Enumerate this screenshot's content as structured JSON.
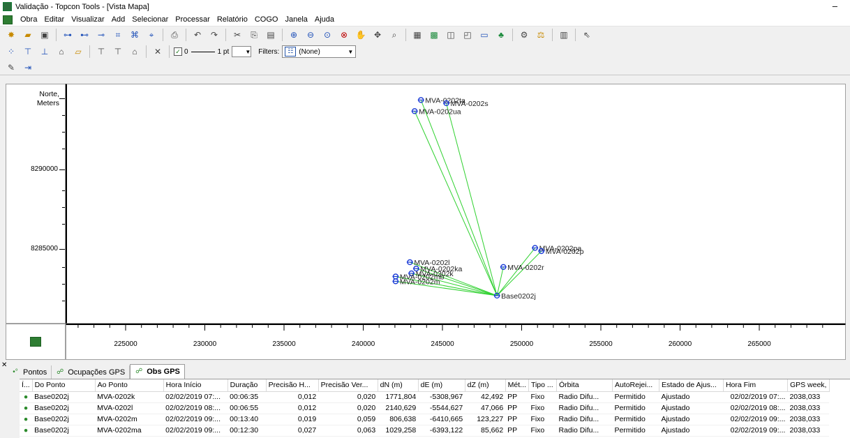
{
  "window": {
    "title": "Validação - Topcon Tools - [Vista Mapa]",
    "minimize": "–"
  },
  "menu": [
    "Obra",
    "Editar",
    "Visualizar",
    "Add",
    "Selecionar",
    "Processar",
    "Relatório",
    "COGO",
    "Janela",
    "Ajuda"
  ],
  "toolbar": {
    "line_weight_value": "0",
    "line_width_label": "1 pt",
    "filters_label": "Filters:",
    "filter_value": "(None)"
  },
  "map": {
    "y_axis_title": [
      "Norte,",
      "Meters"
    ],
    "y_ticks": [
      "8290000",
      "8285000"
    ],
    "x_ticks": [
      "225000",
      "230000",
      "235000",
      "240000",
      "245000",
      "250000",
      "255000",
      "260000",
      "265000"
    ],
    "points": [
      {
        "label": "MVA-0202ta",
        "x": 243.6,
        "y": 8294.5
      },
      {
        "label": "MVA-0202s",
        "x": 245.2,
        "y": 8294.3
      },
      {
        "label": "MVA-0202ua",
        "x": 243.2,
        "y": 8293.8
      },
      {
        "label": "MVA-0202pa",
        "x": 250.8,
        "y": 8285.2
      },
      {
        "label": "MVA-0202p",
        "x": 251.2,
        "y": 8285.0
      },
      {
        "label": "MVA-0202r",
        "x": 248.8,
        "y": 8284.0
      },
      {
        "label": "MVA-0202l",
        "x": 242.9,
        "y": 8284.3
      },
      {
        "label": "MVA-0202ka",
        "x": 243.3,
        "y": 8283.9
      },
      {
        "label": "MVA-0202k",
        "x": 243.0,
        "y": 8283.6
      },
      {
        "label": "MVA-0202mb",
        "x": 242.0,
        "y": 8283.4
      },
      {
        "label": "MVA-0202m",
        "x": 242.0,
        "y": 8283.1
      },
      {
        "label": "Base0202j",
        "x": 248.4,
        "y": 8282.2
      }
    ],
    "base_label": "Base0202j"
  },
  "tabs": [
    "Pontos",
    "Ocupações GPS",
    "Obs GPS"
  ],
  "table": {
    "columns": [
      "Í...",
      "Do Ponto",
      "Ao Ponto",
      "Hora Início",
      "Duração",
      "Precisão H...",
      "Precisão Ver...",
      "dN (m)",
      "dE (m)",
      "dZ (m)",
      "Mét...",
      "Tipo ...",
      "Órbita",
      "AutoRejei...",
      "Estado de Ajus...",
      "Hora Fim",
      "GPS week,"
    ],
    "rows": [
      [
        "Base0202j",
        "MVA-0202k",
        "02/02/2019 07:...",
        "00:06:35",
        "0,012",
        "0,020",
        "1771,804",
        "-5308,967",
        "42,492",
        "PP",
        "Fixo",
        "Radio Difu...",
        "Permitido",
        "Ajustado",
        "02/02/2019 07:...",
        "2038,033"
      ],
      [
        "Base0202j",
        "MVA-0202l",
        "02/02/2019 08:...",
        "00:06:55",
        "0,012",
        "0,020",
        "2140,629",
        "-5544,627",
        "47,066",
        "PP",
        "Fixo",
        "Radio Difu...",
        "Permitido",
        "Ajustado",
        "02/02/2019 08:...",
        "2038,033"
      ],
      [
        "Base0202j",
        "MVA-0202m",
        "02/02/2019 09:...",
        "00:13:40",
        "0,019",
        "0,059",
        "806,638",
        "-6410,665",
        "123,227",
        "PP",
        "Fixo",
        "Radio Difu...",
        "Permitido",
        "Ajustado",
        "02/02/2019 09:...",
        "2038,033"
      ],
      [
        "Base0202j",
        "MVA-0202ma",
        "02/02/2019 09:...",
        "00:12:30",
        "0,027",
        "0,063",
        "1029,258",
        "-6393,122",
        "85,662",
        "PP",
        "Fixo",
        "Radio Difu...",
        "Permitido",
        "Ajustado",
        "02/02/2019 09:...",
        "2038,033"
      ]
    ]
  },
  "colors": {
    "vector": "#2fd12f",
    "point": "#1a3bd6",
    "accent_green": "#2e7d32"
  }
}
